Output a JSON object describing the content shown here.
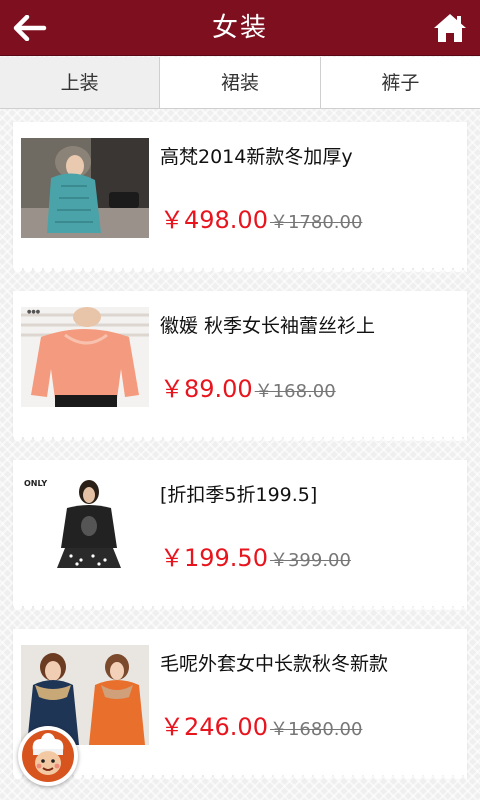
{
  "header": {
    "title": "女装",
    "back_icon": "arrow-left-icon",
    "home_icon": "home-icon",
    "bg_color": "#7d0f1f"
  },
  "tabs": [
    {
      "label": "上装",
      "active": true
    },
    {
      "label": "裙装",
      "active": false
    },
    {
      "label": "裤子",
      "active": false
    }
  ],
  "products": [
    {
      "name": "高梵2014新款冬加厚y",
      "price": "￥498.00",
      "original_price": "￥1780.00",
      "image": "down-jacket-photo"
    },
    {
      "name": "徽媛 秋季女长袖蕾丝衫上",
      "price": "￥89.00",
      "original_price": "￥168.00",
      "image": "lace-top-photo"
    },
    {
      "name": "[折扣季5折199.5]",
      "price": "￥199.50",
      "original_price": "￥399.00",
      "image": "only-sweater-photo",
      "brand_logo": "ONLY"
    },
    {
      "name": "毛呢外套女中长款秋冬新款",
      "price": "￥246.00",
      "original_price": "￥1680.00",
      "image": "wool-coat-photo"
    }
  ],
  "colors": {
    "price": "#e8141e",
    "original_price": "#777777"
  },
  "floating_button": {
    "icon": "chef-avatar-icon"
  }
}
